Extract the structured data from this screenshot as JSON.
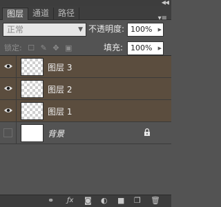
{
  "tabs": [
    {
      "label": "图层",
      "active": true
    },
    {
      "label": "通道",
      "active": false
    },
    {
      "label": "路径",
      "active": false
    }
  ],
  "blend_mode": {
    "value": "正常"
  },
  "opacity": {
    "label": "不透明度:",
    "value": "100%"
  },
  "lock": {
    "label": "锁定:"
  },
  "fill": {
    "label": "填充:",
    "value": "100%"
  },
  "layers": [
    {
      "name": "图层 3",
      "visible": true,
      "selected": true,
      "thumbnail": "transparent"
    },
    {
      "name": "图层 2",
      "visible": true,
      "selected": true,
      "thumbnail": "transparent"
    },
    {
      "name": "图层 1",
      "visible": true,
      "selected": true,
      "thumbnail": "transparent"
    },
    {
      "name": "背景",
      "visible": false,
      "selected": false,
      "thumbnail": "white",
      "locked": true
    }
  ],
  "colors": {
    "selected_row": "#5b4d3e",
    "panel_bg": "#535353"
  },
  "bottom_icons": [
    "link-icon",
    "fx-icon",
    "mask-icon",
    "adjustment-icon",
    "folder-icon",
    "new-layer-icon",
    "trash-icon"
  ]
}
